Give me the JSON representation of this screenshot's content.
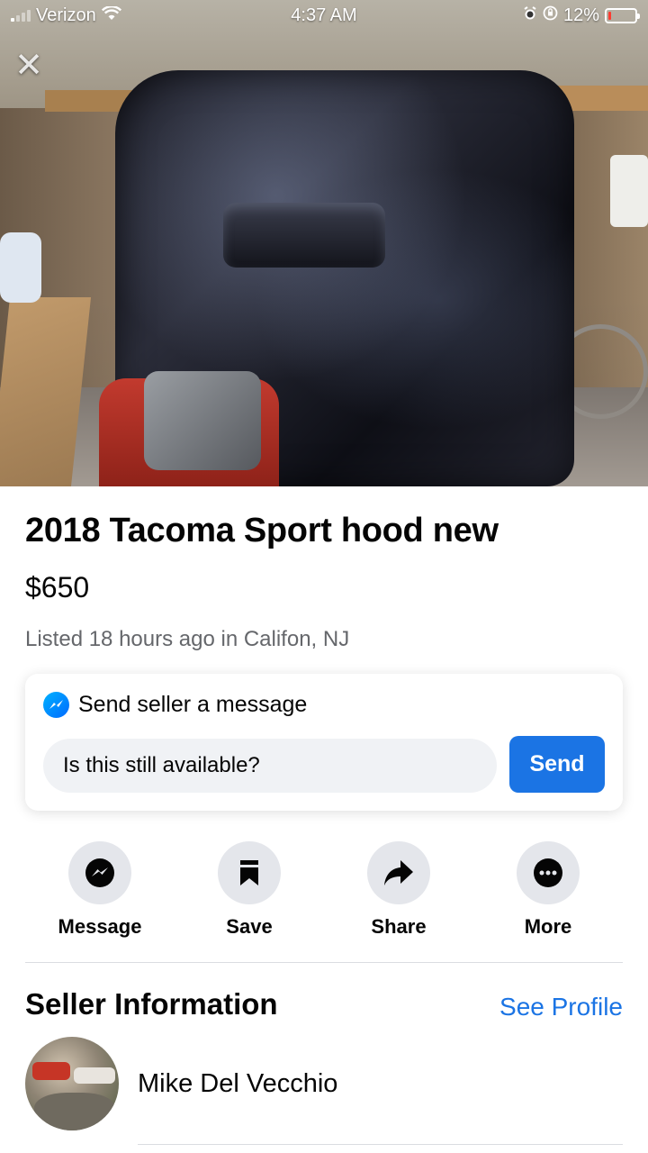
{
  "status_bar": {
    "carrier": "Verizon",
    "time": "4:37 AM",
    "battery_percent": "12%",
    "battery_level": 0.12,
    "icons": [
      "signal-icon",
      "wifi-icon",
      "alarm-icon",
      "orientation-lock-icon",
      "battery-icon"
    ]
  },
  "hero": {
    "close_icon": "close-icon"
  },
  "listing": {
    "title": "2018 Tacoma Sport hood new",
    "price": "$650",
    "listed": "Listed 18 hours ago in Califon, NJ"
  },
  "message_card": {
    "heading": "Send seller a message",
    "input_value": "Is this still available?",
    "send_label": "Send",
    "icon": "messenger-icon"
  },
  "actions": [
    {
      "label": "Message",
      "icon": "messenger-icon"
    },
    {
      "label": "Save",
      "icon": "bookmark-icon"
    },
    {
      "label": "Share",
      "icon": "share-arrow-icon"
    },
    {
      "label": "More",
      "icon": "more-dots-icon"
    }
  ],
  "seller": {
    "heading": "Seller Information",
    "see_profile": "See Profile",
    "name": "Mike Del Vecchio"
  },
  "colors": {
    "accent": "#1b74e4",
    "secondary_text": "#65676b",
    "action_bg": "#e4e6eb",
    "battery_low": "#ff3b30"
  }
}
